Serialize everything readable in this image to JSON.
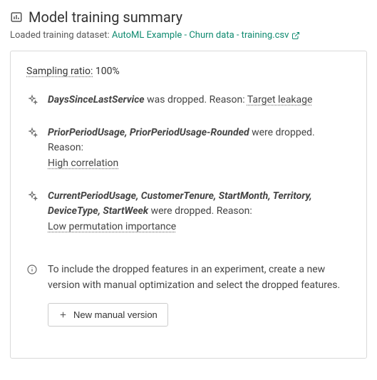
{
  "header": {
    "title": "Model training summary",
    "icon": "bar-chart-icon"
  },
  "dataset": {
    "label": "Loaded training dataset:",
    "link_text": "AutoML Example - Churn data - training.csv",
    "ext_icon": "external-link-icon"
  },
  "sampling": {
    "label": "Sampling ratio:",
    "value": "100%"
  },
  "drops": [
    {
      "features": "DaysSinceLastService",
      "suffix": " was dropped. Reason: ",
      "reason": "Target leakage",
      "reason_inline": true
    },
    {
      "features": "PriorPeriodUsage, PriorPeriodUsage-Rounded",
      "suffix": " were dropped.",
      "reason_prefix": "Reason:",
      "reason": "High correlation",
      "reason_inline": false
    },
    {
      "features": "CurrentPeriodUsage, CustomerTenure, StartMonth, Territory, DeviceType, StartWeek",
      "suffix": " were dropped. Reason:",
      "reason": "Low permutation importance",
      "reason_inline": false
    }
  ],
  "info": {
    "text": "To include the dropped features in an experiment, create a new version with manual optimization and select the dropped features.",
    "button_label": "New manual version",
    "info_icon": "info-icon",
    "plus_icon": "plus-icon"
  }
}
